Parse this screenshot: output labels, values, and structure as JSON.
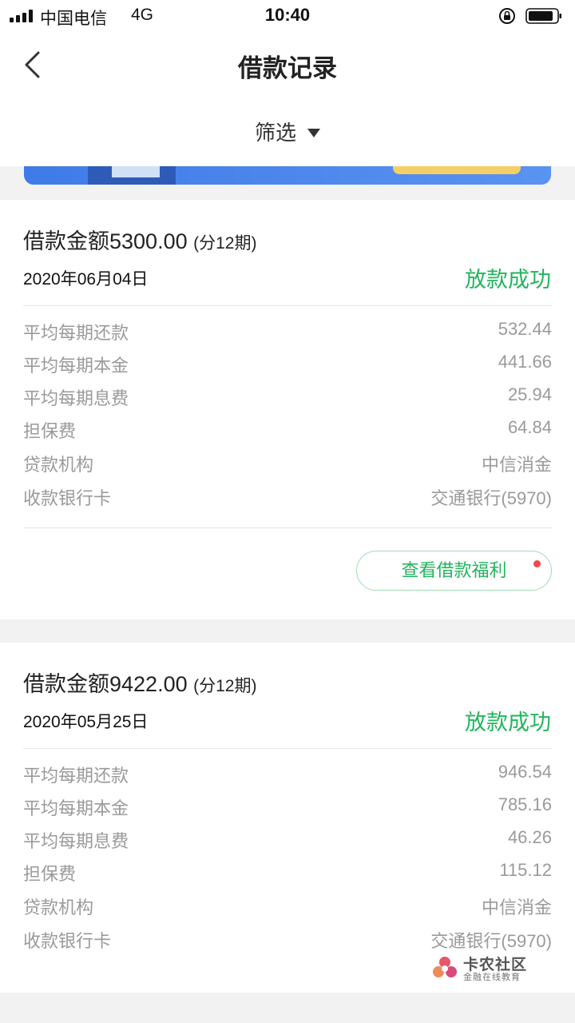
{
  "status_bar": {
    "carrier": "中国电信",
    "network": "4G",
    "time": "10:40"
  },
  "nav": {
    "title": "借款记录",
    "back_icon": "chevron-left-icon"
  },
  "filter": {
    "label": "筛选",
    "icon": "caret-down-icon"
  },
  "loans": [
    {
      "title": "借款金额5300.00",
      "installments": "(分12期)",
      "date": "2020年06月04日",
      "status": "放款成功",
      "rows": [
        {
          "label": "平均每期还款",
          "value": "532.44"
        },
        {
          "label": "平均每期本金",
          "value": "441.66"
        },
        {
          "label": "平均每期息费",
          "value": "25.94"
        },
        {
          "label": "担保费",
          "value": "64.84"
        },
        {
          "label": "贷款机构",
          "value": "中信消金"
        },
        {
          "label": "收款银行卡",
          "value": "交通银行(5970)"
        }
      ],
      "welfare_button": "查看借款福利"
    },
    {
      "title": "借款金额9422.00",
      "installments": "(分12期)",
      "date": "2020年05月25日",
      "status": "放款成功",
      "rows": [
        {
          "label": "平均每期还款",
          "value": "946.54"
        },
        {
          "label": "平均每期本金",
          "value": "785.16"
        },
        {
          "label": "平均每期息费",
          "value": "46.26"
        },
        {
          "label": "担保费",
          "value": "115.12"
        },
        {
          "label": "贷款机构",
          "value": "中信消金"
        },
        {
          "label": "收款银行卡",
          "value": "交通银行(5970)"
        }
      ]
    }
  ],
  "watermark": {
    "name": "卡农社区",
    "tagline": "金融在线教育"
  },
  "colors": {
    "success": "#21b55c",
    "muted_text": "#9a9a9a",
    "background": "#f2f2f2"
  }
}
